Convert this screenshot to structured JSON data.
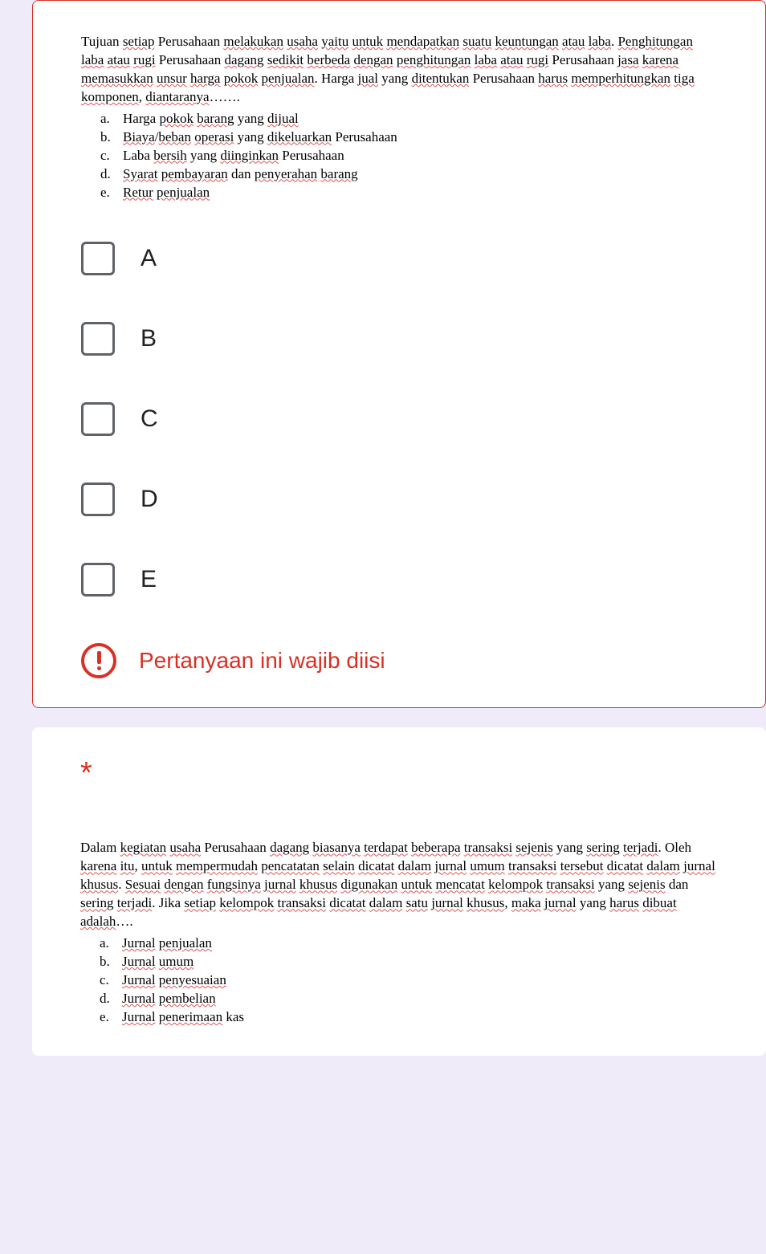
{
  "q1": {
    "paragraph_plain": "Tujuan setiap Perusahaan melakukan usaha yaitu untuk mendapatkan suatu keuntungan atau laba. Penghitungan laba atau rugi Perusahaan dagang sedikit berbeda dengan penghitungan laba atau rugi Perusahaan jasa karena memasukkan unsur harga pokok penjualan. Harga jual yang ditentukan Perusahaan harus memperhitungkan tiga komponen, diantaranya…….",
    "list_items": [
      "Harga pokok barang yang dijual",
      "Biaya/beban operasi yang dikeluarkan Perusahaan",
      "Laba bersih yang diinginkan Perusahaan",
      "Syarat pembayaran dan penyerahan barang",
      "Retur penjualan"
    ],
    "options": [
      "A",
      "B",
      "C",
      "D",
      "E"
    ],
    "error_message": "Pertanyaan ini wajib diisi"
  },
  "q2": {
    "required_marker": "*",
    "paragraph_plain": "Dalam kegiatan usaha Perusahaan dagang biasanya terdapat beberapa transaksi sejenis yang sering terjadi. Oleh karena itu, untuk mempermudah pencatatan selain dicatat dalam jurnal umum transaksi tersebut dicatat dalam jurnal khusus. Sesuai dengan fungsinya jurnal khusus digunakan untuk mencatat kelompok transaksi yang sejenis dan sering terjadi. Jika setiap kelompok transaksi dicatat dalam satu jurnal khusus, maka jurnal yang harus dibuat adalah….",
    "list_items": [
      "Jurnal penjualan",
      "Jurnal umum",
      "Jurnal penyesuaian",
      "Jurnal pembelian",
      "Jurnal penerimaan kas"
    ]
  }
}
